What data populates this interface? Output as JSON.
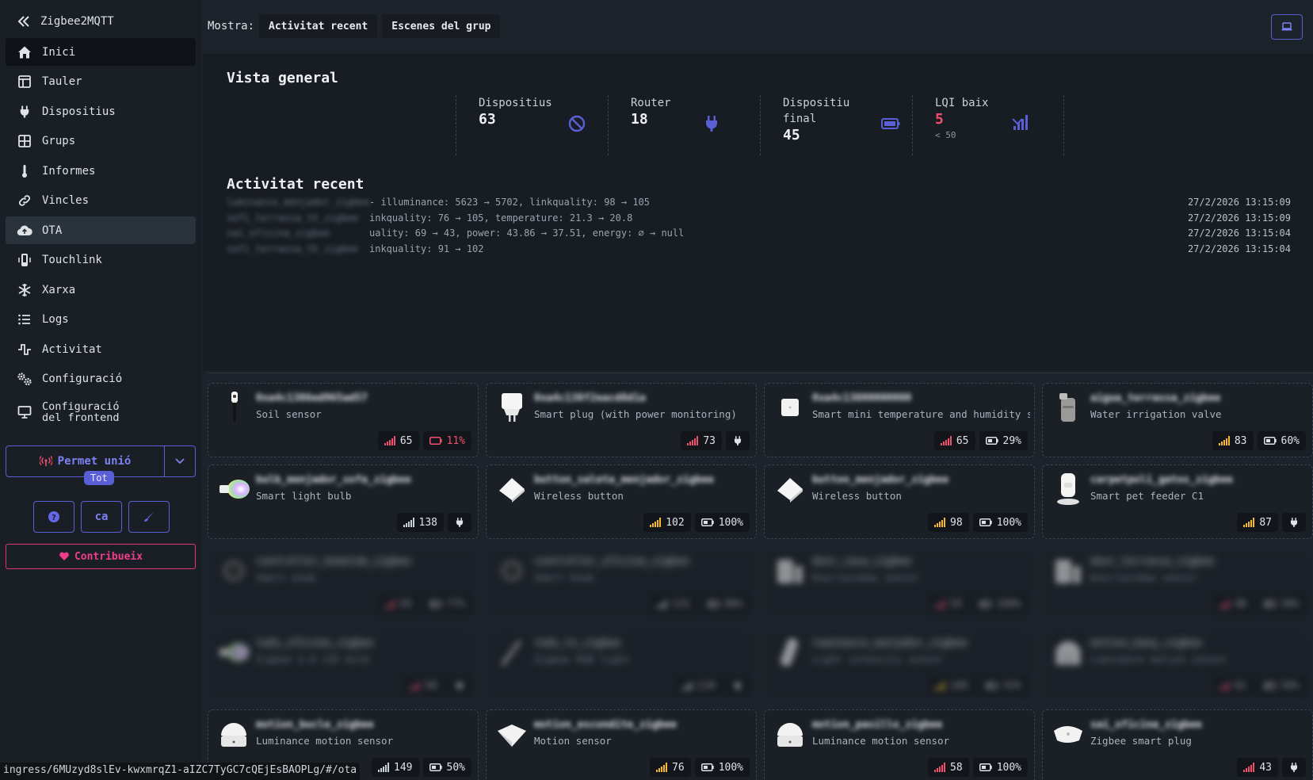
{
  "sidebar": {
    "app_title": "Zigbee2MQTT",
    "items": [
      {
        "label": "Inici",
        "icon": "home-icon",
        "state": "active"
      },
      {
        "label": "Tauler",
        "icon": "dashboard-icon",
        "state": ""
      },
      {
        "label": "Dispositius",
        "icon": "plug-icon",
        "state": ""
      },
      {
        "label": "Grups",
        "icon": "grid-icon",
        "state": ""
      },
      {
        "label": "Informes",
        "icon": "thermometer-icon",
        "state": ""
      },
      {
        "label": "Vincles",
        "icon": "link-icon",
        "state": ""
      },
      {
        "label": "OTA",
        "icon": "cloud-upload-icon",
        "state": "hover"
      },
      {
        "label": "Touchlink",
        "icon": "touchlink-icon",
        "state": ""
      },
      {
        "label": "Xarxa",
        "icon": "network-icon",
        "state": ""
      },
      {
        "label": "Logs",
        "icon": "list-icon",
        "state": ""
      },
      {
        "label": "Activitat",
        "icon": "activity-icon",
        "state": ""
      },
      {
        "label": "Configuració",
        "icon": "gears-icon",
        "state": ""
      },
      {
        "label": "Configuració\ndel frontend",
        "icon": "monitor-icon",
        "state": ""
      }
    ],
    "permit_join": "Permet unió",
    "permit_join_target": "Tot",
    "lang_button": "ca",
    "contribute": "Contribueix",
    "help_icon": "question-icon",
    "theme_icon": "brush-icon"
  },
  "topbar": {
    "show_label": "Mostra:",
    "tabs": [
      "Activitat recent",
      "Escenes del grup"
    ]
  },
  "overview": {
    "title": "Vista general",
    "stats": [
      {
        "title": "Dispositius",
        "value": "63",
        "detail": "",
        "icon": "ban-icon",
        "color": "#5b5fd6"
      },
      {
        "title": "Router",
        "value": "18",
        "detail": "",
        "icon": "plug-icon",
        "color": "#5b5fd6"
      },
      {
        "title": "Dispositiu\nfinal",
        "value": "45",
        "detail": "",
        "icon": "battery-icon",
        "color": "#5b5fd6"
      },
      {
        "title": "LQI baix",
        "value": "5",
        "detail": "< 50",
        "icon": "signal-low-icon",
        "color": "#f0506e"
      }
    ]
  },
  "activity": {
    "title": "Activitat recent",
    "rows": [
      {
        "device": "luminance_menjador_zigbee",
        "message": "- illuminance: 5623 → 5702, linkquality: 98 → 105",
        "time": "27/2/2026 13:15:09"
      },
      {
        "device": "sofi_terrassa_th_zigbee",
        "message": "inkquality: 76 → 105, temperature: 21.3 → 20.8",
        "time": "27/2/2026 13:15:09"
      },
      {
        "device": "sai_oficina_zigbee",
        "message": "uality: 69 → 43, power: 43.86 → 37.51, energy: ∅ → null",
        "time": "27/2/2026 13:15:04"
      },
      {
        "device": "sofi_terrassa_th_zigbee",
        "message": "inkquality: 91 → 102",
        "time": "27/2/2026 13:15:04"
      }
    ]
  },
  "devices": [
    {
      "name": "0xa4c1386ed965ad57",
      "model": "Soil sensor",
      "lqi": "65",
      "lqi_color": "#f0506e",
      "power": "11%",
      "power_type": "battery-low",
      "blurred": false,
      "img": "soil"
    },
    {
      "name": "0xa4c138f2eacd8d1a",
      "model": "Smart plug (with power monitoring)",
      "lqi": "73",
      "lqi_color": "#f0506e",
      "power": "",
      "power_type": "mains",
      "blurred": false,
      "img": "plug"
    },
    {
      "name": "0xa4c13800000000",
      "model": "Smart mini temperature and humidity s…",
      "lqi": "65",
      "lqi_color": "#f0506e",
      "power": "29%",
      "power_type": "battery",
      "blurred": false,
      "img": "temp"
    },
    {
      "name": "aigua_terrassa_zigbee",
      "model": "Water irrigation valve",
      "lqi": "83",
      "lqi_color": "#f5b82e",
      "power": "60%",
      "power_type": "battery",
      "blurred": false,
      "img": "valve"
    },
    {
      "name": "bulb_menjador_sofa_zigbee",
      "model": "Smart light bulb",
      "lqi": "138",
      "lqi_color": "#c9d1d9",
      "power": "",
      "power_type": "mains",
      "blurred": false,
      "img": "bulb"
    },
    {
      "name": "button_saleta_menjador_zigbee",
      "model": "Wireless button",
      "lqi": "102",
      "lqi_color": "#f5b82e",
      "power": "100%",
      "power_type": "battery",
      "blurred": false,
      "img": "button"
    },
    {
      "name": "button_menjador_zigbee",
      "model": "Wireless button",
      "lqi": "98",
      "lqi_color": "#f5b82e",
      "power": "100%",
      "power_type": "battery",
      "blurred": false,
      "img": "button"
    },
    {
      "name": "carpetpoli_gatos_zigbee",
      "model": "Smart pet feeder C1",
      "lqi": "87",
      "lqi_color": "#f5b82e",
      "power": "",
      "power_type": "mains",
      "blurred": false,
      "img": "feeder"
    },
    {
      "name": "controller_homelab_zigbee",
      "model": "Smart knob",
      "lqi": "65",
      "lqi_color": "#f0506e",
      "power": "77%",
      "power_type": "battery",
      "blurred": true,
      "img": "knob"
    },
    {
      "name": "controller_oficina_zigbee",
      "model": "Smart knob",
      "lqi": "131",
      "lqi_color": "#c9d1d9",
      "power": "86%",
      "power_type": "battery",
      "blurred": true,
      "img": "knob"
    },
    {
      "name": "door_casa_zigbee",
      "model": "Door/window sensor",
      "lqi": "55",
      "lqi_color": "#f0506e",
      "power": "100%",
      "power_type": "battery",
      "blurred": true,
      "img": "door"
    },
    {
      "name": "door_terrassa_zigbee",
      "model": "Door/window sensor",
      "lqi": "48",
      "lqi_color": "#f0506e",
      "power": "58%",
      "power_type": "battery",
      "blurred": true,
      "img": "door"
    },
    {
      "name": "leds_oficina_zigbee",
      "model": "Zigbee 3.0 LED bulb",
      "lqi": "50",
      "lqi_color": "#f0506e",
      "power": "",
      "power_type": "mains",
      "blurred": true,
      "img": "bulb"
    },
    {
      "name": "leds_tv_zigbee",
      "model": "Zigbee RGB light",
      "lqi": "110",
      "lqi_color": "#c9d1d9",
      "power": "",
      "power_type": "mains",
      "blurred": true,
      "img": "strip"
    },
    {
      "name": "luminance_menjador_zigbee",
      "model": "Light intensity sensor",
      "lqi": "105",
      "lqi_color": "#f5b82e",
      "power": "32%",
      "power_type": "battery",
      "blurred": true,
      "img": "lum"
    },
    {
      "name": "motion_bany_zigbee",
      "model": "Luminance motion sensor",
      "lqi": "61",
      "lqi_color": "#f0506e",
      "power": "58%",
      "power_type": "battery",
      "blurred": true,
      "img": "motion"
    },
    {
      "name": "motion_bucle_zigbee",
      "model": "Luminance motion sensor",
      "lqi": "149",
      "lqi_color": "#c9d1d9",
      "power": "50%",
      "power_type": "battery",
      "blurred": false,
      "img": "motion"
    },
    {
      "name": "motion_escondite_zigbee",
      "model": "Motion sensor",
      "lqi": "76",
      "lqi_color": "#f5b82e",
      "power": "100%",
      "power_type": "battery",
      "blurred": false,
      "img": "motion2"
    },
    {
      "name": "motion_pasillo_zigbee",
      "model": "Luminance motion sensor",
      "lqi": "58",
      "lqi_color": "#f0506e",
      "power": "100%",
      "power_type": "battery",
      "blurred": false,
      "img": "motion"
    },
    {
      "name": "sai_oficina_zigbee",
      "model": "Zigbee smart plug",
      "lqi": "43",
      "lqi_color": "#f0506e",
      "power": "",
      "power_type": "mains",
      "blurred": false,
      "img": "plug2"
    }
  ],
  "status_url": "ingress/6MUzyd8slEv-kwxmrqZ1-aIZC7TyGC7cQEjEsBAOPLg/#/ota"
}
